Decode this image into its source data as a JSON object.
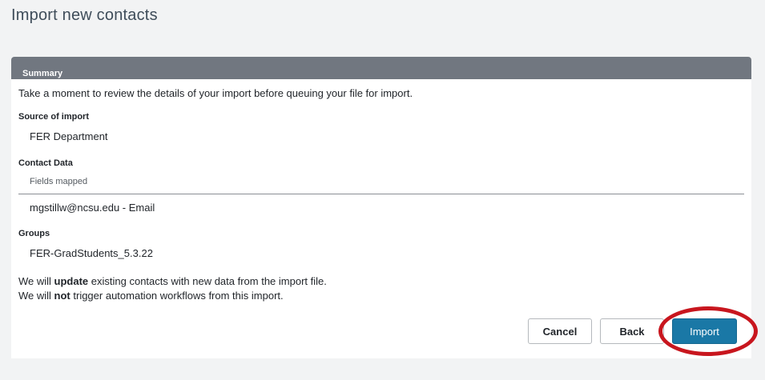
{
  "page": {
    "title": "Import new contacts"
  },
  "summary": {
    "header": "Summary",
    "intro": "Take a moment to review the details of your import before queuing your file for import.",
    "source_label": "Source of import",
    "source_value": "FER Department",
    "contact_data_label": "Contact Data",
    "fields_mapped_label": "Fields mapped",
    "mapped_field": "mgstillw@ncsu.edu - Email",
    "groups_label": "Groups",
    "group_value": "FER-GradStudents_5.3.22",
    "note1": {
      "prefix": "We will ",
      "emphasis": "update",
      "suffix": " existing contacts with new data from the import file."
    },
    "note2": {
      "prefix": "We will ",
      "emphasis": "not",
      "suffix": " trigger automation workflows from this import."
    }
  },
  "actions": {
    "cancel_label": "Cancel",
    "back_label": "Back",
    "import_label": "Import"
  },
  "colors": {
    "header_bg": "#717780",
    "primary_button": "#1a78a6",
    "highlight_ring": "#c8161e"
  }
}
